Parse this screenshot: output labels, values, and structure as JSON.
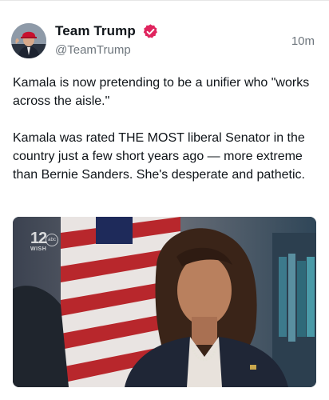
{
  "post": {
    "author": {
      "display_name": "Team Trump",
      "handle": "@TeamTrump",
      "verified": true,
      "verified_badge_color": "#e0245e",
      "avatar": "avatar-photo"
    },
    "time": "10m",
    "text_paragraphs": [
      "Kamala is now pretending to be a unifier who \"works across the aisle.\"",
      "Kamala was rated THE MOST liberal Senator in the country just a few short years ago — more extreme than Bernie Sanders. She's desperate and pathetic."
    ],
    "media": {
      "type": "video-still",
      "channel_logo": {
        "number": "12",
        "network": "abc",
        "call_sign": "WISH"
      }
    }
  }
}
